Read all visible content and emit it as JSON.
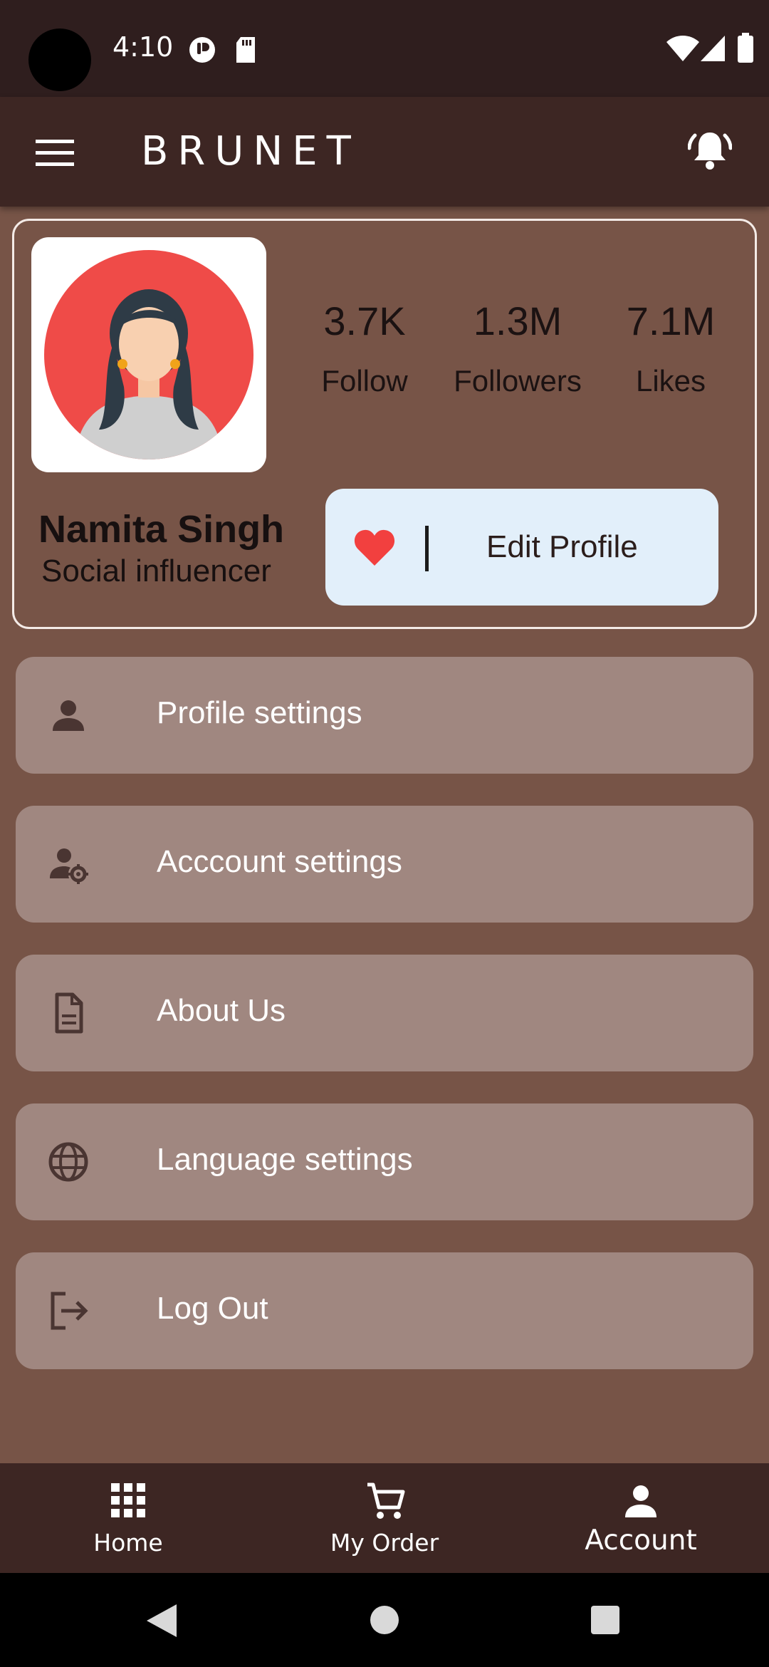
{
  "status_bar": {
    "time": "4:10",
    "icons": [
      "camera-hole",
      "app-notification-icon",
      "sd-card-icon",
      "wifi-icon",
      "signal-icon",
      "battery-icon"
    ]
  },
  "app_bar": {
    "title": "BRUNET",
    "icons": [
      "menu-icon",
      "bell-icon"
    ]
  },
  "profile": {
    "name": "Namita Singh",
    "role": "Social influencer",
    "stats": [
      {
        "value": "3.7K",
        "label": "Follow"
      },
      {
        "value": "1.3M",
        "label": "Followers"
      },
      {
        "value": "7.1M",
        "label": "Likes"
      }
    ],
    "edit_button": {
      "label": "Edit Profile",
      "icon": "heart-icon"
    }
  },
  "menu": [
    {
      "label": "Profile settings",
      "icon": "person-icon"
    },
    {
      "label": "Acccount settings",
      "icon": "person-gear-icon"
    },
    {
      "label": "About Us",
      "icon": "document-icon"
    },
    {
      "label": "Language settings",
      "icon": "globe-icon"
    },
    {
      "label": "Log Out",
      "icon": "logout-icon"
    }
  ],
  "bottom_nav": [
    {
      "label": "Home",
      "icon": "grid-icon"
    },
    {
      "label": "My Order",
      "icon": "cart-icon"
    },
    {
      "label": "Account",
      "icon": "person-icon",
      "active": true
    }
  ],
  "colors": {
    "background": "#775447",
    "app_bar": "#3d2623",
    "status_bar": "#2f1e1e",
    "menu_item": "#a08780",
    "edit_button": "#e2effa",
    "heart": "#f2403f",
    "avatar_circle": "#ef4b48"
  }
}
